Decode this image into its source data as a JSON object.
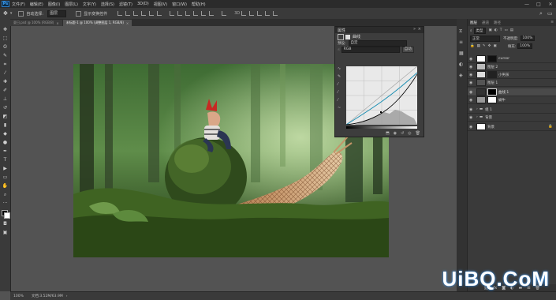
{
  "menu": {
    "logo": "Ps",
    "items": [
      "文件(F)",
      "编辑(E)",
      "图像(I)",
      "图层(L)",
      "文字(Y)",
      "选择(S)",
      "滤镜(T)",
      "3D(D)",
      "视图(V)",
      "窗口(W)",
      "帮助(H)"
    ]
  },
  "window_controls": {
    "minimize": "—",
    "maximize": "□",
    "close": "✕"
  },
  "options": {
    "auto_select_label": "自动选择:",
    "auto_select_value": "图层",
    "show_transform_label": "显示变换控件"
  },
  "tabs": [
    {
      "label": "夏日.psd @ 100% (RGB/8)",
      "active": false
    },
    {
      "label": "未标题-1 @ 100% (调整图层 1, RGB/8)",
      "active": true
    }
  ],
  "properties": {
    "title": "属性",
    "subtitle": "曲线",
    "preset_label": "预设:",
    "preset_value": "自定",
    "channel_value": "RGB",
    "auto_label": "自动"
  },
  "layers_panel": {
    "tabs": [
      "图层",
      "通道",
      "路径"
    ],
    "kind_label": "类型",
    "blend_mode": "正常",
    "opacity_label": "不透明度:",
    "opacity_value": "100%",
    "fill_label": "填充:",
    "fill_value": "100%",
    "layers": [
      {
        "name": "cursor"
      },
      {
        "name": "图层 2"
      },
      {
        "name": "小男孩"
      },
      {
        "name": "图层 1"
      },
      {
        "name": "曲线 1"
      },
      {
        "name": "蜗牛"
      },
      {
        "name": "组 1"
      },
      {
        "name": "背景"
      },
      {
        "name": "背景"
      }
    ]
  },
  "status": {
    "zoom": "100%",
    "doc_info": "文档:3.52M/63.9M"
  },
  "watermark": "UiBQ.CoM"
}
